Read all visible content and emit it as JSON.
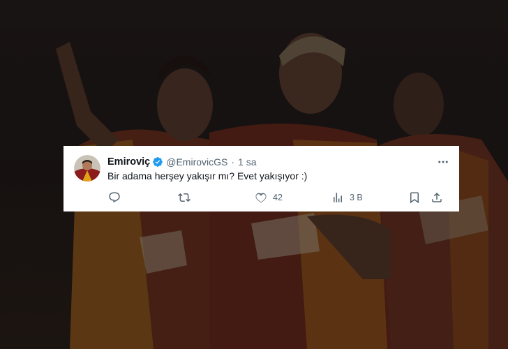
{
  "tweet": {
    "display_name": "Emiroviç",
    "handle": "@EmirovicGS",
    "separator": "·",
    "time": "1 sa",
    "text": "Bir adama herşey yakışır mı? Evet yakışıyor :)",
    "verified": true,
    "stats": {
      "replies": "",
      "retweets": "",
      "likes": "42",
      "views": "3 B"
    }
  },
  "icons": {
    "verified": "verified-badge-icon",
    "more": "more-dots-icon",
    "reply": "reply-icon",
    "retweet": "retweet-icon",
    "like": "heart-icon",
    "views": "views-chart-icon",
    "bookmark": "bookmark-icon",
    "share": "share-icon"
  },
  "colors": {
    "verified_blue": "#1d9bf0",
    "text_primary": "#0f1419",
    "text_secondary": "#536471",
    "card_background": "#ffffff"
  }
}
